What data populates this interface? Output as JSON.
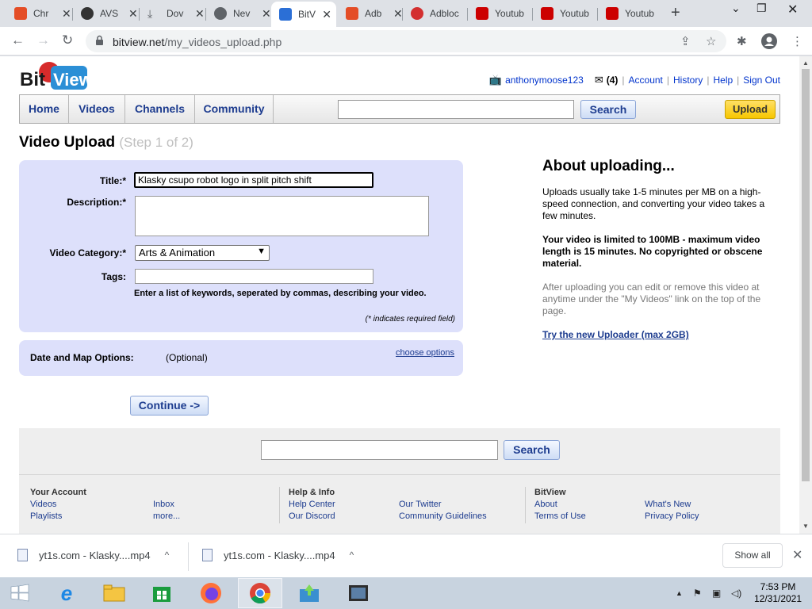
{
  "browser": {
    "tabs": [
      {
        "label": "Chr",
        "color": "#e44d26"
      },
      {
        "label": "AVS",
        "color": "#333333"
      },
      {
        "label": "Dov",
        "color": "#5f6368"
      },
      {
        "label": "Nev",
        "color": "#5f6368"
      },
      {
        "label": "BitV",
        "color": "#2b6fd6"
      },
      {
        "label": "Adb",
        "color": "#e44d26"
      },
      {
        "label": "Adbloc",
        "color": "#d32f2f"
      },
      {
        "label": "Youtub",
        "color": "#cc0000"
      },
      {
        "label": "Youtub",
        "color": "#cc0000"
      },
      {
        "label": "Youtub",
        "color": "#cc0000"
      }
    ],
    "active_tab": 4,
    "url_host": "bitview.net",
    "url_path": "/my_videos_upload.php"
  },
  "site": {
    "logo_text": "BitView",
    "username": "anthonymoose123",
    "inbox_count": "(4)",
    "links": [
      "Account",
      "History",
      "Help",
      "Sign Out"
    ],
    "nav": [
      "Home",
      "Videos",
      "Channels",
      "Community"
    ],
    "search_label": "Search",
    "upload_label": "Upload"
  },
  "form": {
    "heading": "Video Upload",
    "step": "(Step 1 of 2)",
    "title_label": "Title:*",
    "title_value": "Klasky csupo robot logo in split pitch shift",
    "description_label": "Description:*",
    "description_value": "",
    "category_label": "Video Category:*",
    "category_value": "Arts & Animation",
    "tags_label": "Tags:",
    "tags_value": "",
    "tags_hint": "Enter a list of keywords, seperated by commas, describing your video.",
    "required_note": "(* indicates required field)",
    "date_label": "Date and Map Options:",
    "date_optional": "(Optional)",
    "choose_options": "choose options",
    "continue_label": "Continue ->"
  },
  "about": {
    "heading": "About uploading...",
    "p1": "Uploads usually take 1-5 minutes per MB on a high-speed connection, and converting your video takes a few minutes.",
    "p2": "Your video is limited to 100MB - maximum video length is 15 minutes. No copyrighted or obscene material.",
    "p3": "After uploading you can edit or remove this video at anytime under the \"My Videos\" link on the top of the page.",
    "link": "Try the new Uploader (max 2GB)"
  },
  "footer": {
    "search_label": "Search",
    "col1_title": "Your Account",
    "col1_links": [
      "Videos",
      "Playlists",
      "Inbox",
      "more..."
    ],
    "col2_title": "Help & Info",
    "col2_links": [
      "Help Center",
      "Our Discord",
      "Our Twitter",
      "Community Guidelines"
    ],
    "col3_title": "BitView",
    "col3_links": [
      "About",
      "Terms of Use",
      "What's New",
      "Privacy Policy"
    ]
  },
  "downloads": {
    "items": [
      "yt1s.com - Klasky....mp4",
      "yt1s.com - Klasky....mp4"
    ],
    "show_all": "Show all"
  },
  "taskbar": {
    "time": "7:53 PM",
    "date": "12/31/2021"
  }
}
